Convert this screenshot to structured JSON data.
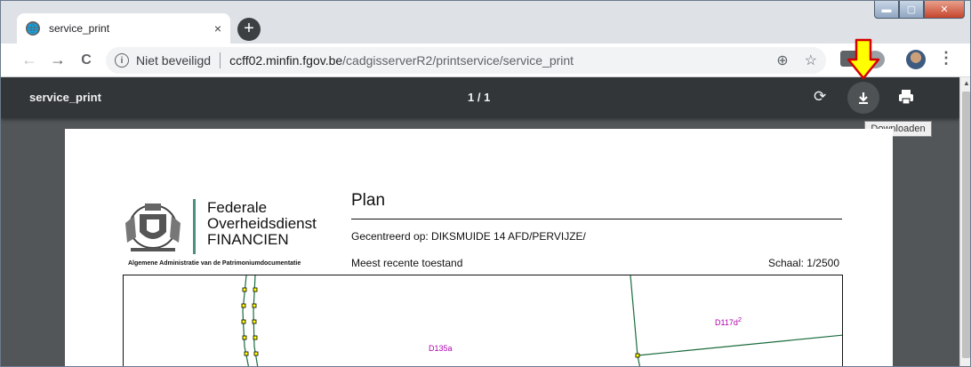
{
  "browser": {
    "tab": {
      "title": "service_print",
      "close_glyph": "×"
    },
    "newtab_glyph": "+",
    "nav": {
      "back": "←",
      "forward": "→",
      "reload": "C"
    },
    "omnibox": {
      "security_label": "Niet beveiligd",
      "host": "ccff02.minfin.fgov.be",
      "path": "/cadgisserverR2/printservice/service_print"
    },
    "menu_glyph": "⋮"
  },
  "caption": {
    "minimize": "▬",
    "maximize": "▢",
    "close": "✕"
  },
  "pdf_viewer": {
    "file_name": "service_print",
    "page_indicator": "1 / 1",
    "download_tooltip": "Downloaden"
  },
  "document": {
    "logo_lines": [
      "Federale",
      "Overheidsdienst",
      "FINANCIEN"
    ],
    "logo_subtitle": "Algemene Administratie van de Patrimoniumdocumentatie",
    "title": "Plan",
    "centered_on": "Gecentreerd op: DIKSMUIDE 14 AFD/PERVIJZE/",
    "state": "Meest recente toestand",
    "scale": "Schaal: 1/2500",
    "parcels": [
      {
        "id": "D117d",
        "sup": "2"
      },
      {
        "id": "D135a",
        "sup": ""
      }
    ]
  },
  "colors": {
    "parcel_label": "#b000b0",
    "parcel_line": "#1a6b3c",
    "annotation_arrow": "#ffff00"
  }
}
